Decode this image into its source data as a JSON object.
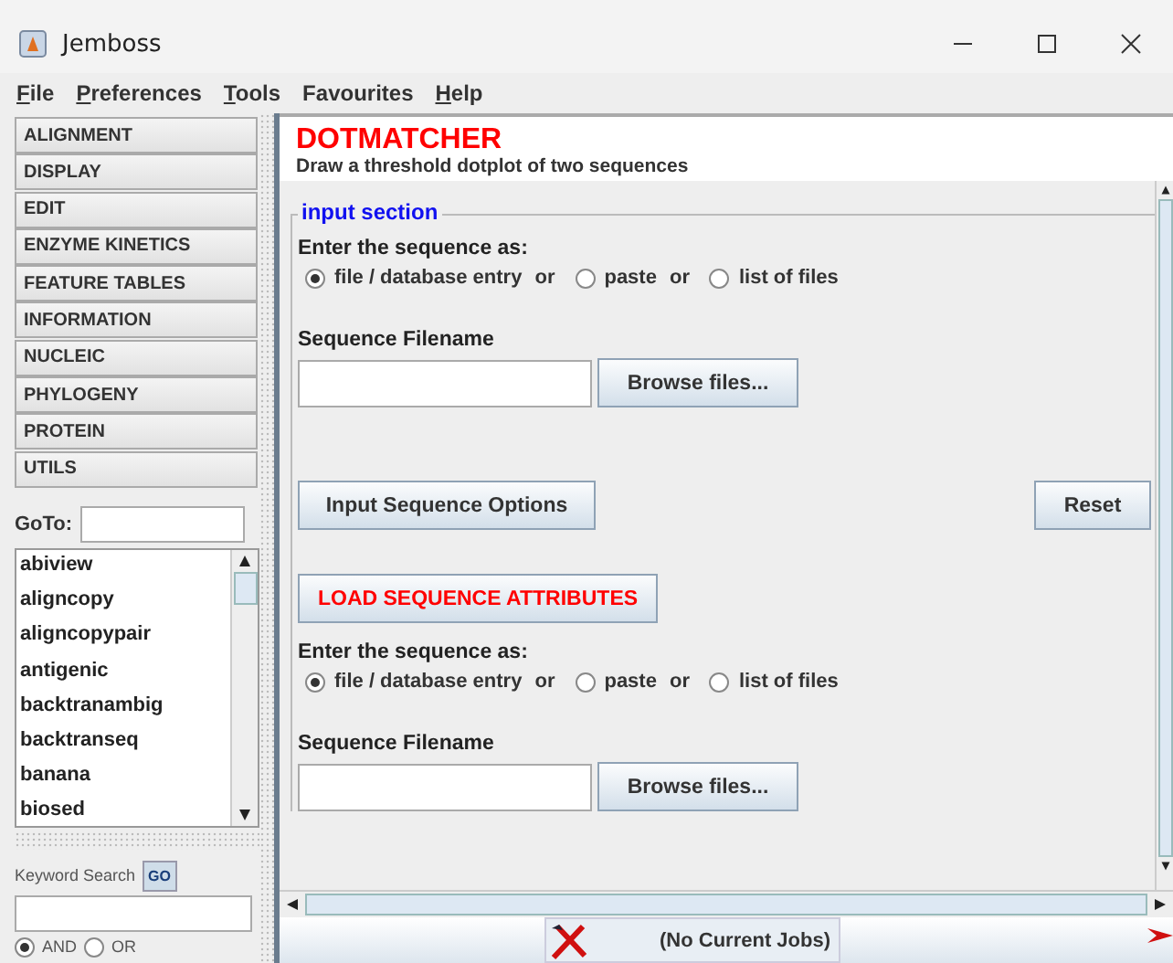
{
  "window": {
    "title": "Jemboss"
  },
  "menu": [
    {
      "label": "File",
      "mnemonic": true
    },
    {
      "label": "Preferences",
      "mnemonic": true
    },
    {
      "label": "Tools",
      "mnemonic": true
    },
    {
      "label": "Favourites",
      "mnemonic": false
    },
    {
      "label": "Help",
      "mnemonic": true
    }
  ],
  "categories": [
    "ALIGNMENT",
    "DISPLAY",
    "EDIT",
    "ENZYME KINETICS",
    "FEATURE TABLES",
    "INFORMATION",
    "NUCLEIC",
    "PHYLOGENY",
    "PROTEIN",
    "UTILS"
  ],
  "goto": {
    "label": "GoTo:"
  },
  "programs": [
    "abiview",
    "aligncopy",
    "aligncopypair",
    "antigenic",
    "backtranambig",
    "backtranseq",
    "banana",
    "biosed"
  ],
  "keyword_search": {
    "label": "Keyword Search",
    "button": "GO",
    "options": [
      {
        "label": "AND",
        "selected": true
      },
      {
        "label": "OR",
        "selected": false
      }
    ]
  },
  "application": {
    "title": "DOTMATCHER",
    "description": "Draw a threshold dotplot of two sequences",
    "section_title": "input section"
  },
  "inputs": [
    {
      "prompt": "Enter the sequence as:",
      "options": [
        {
          "label": "file / database entry",
          "selected": true
        },
        {
          "label": "paste",
          "selected": false
        },
        {
          "label": "list of files",
          "selected": false
        }
      ],
      "joiners": [
        "or",
        "or"
      ],
      "field_label": "Sequence Filename",
      "browse": "Browse files..."
    },
    {
      "prompt": "Enter the sequence as:",
      "options": [
        {
          "label": "file / database entry",
          "selected": true
        },
        {
          "label": "paste",
          "selected": false
        },
        {
          "label": "list of files",
          "selected": false
        }
      ],
      "joiners": [
        "or",
        "or"
      ],
      "field_label": "Sequence Filename",
      "browse": "Browse files..."
    }
  ],
  "buttons": {
    "options": "Input Sequence Options",
    "reset": "Reset",
    "load": "LOAD SEQUENCE ATTRIBUTES"
  },
  "status_bar": {
    "jobs": "(No Current Jobs)"
  }
}
